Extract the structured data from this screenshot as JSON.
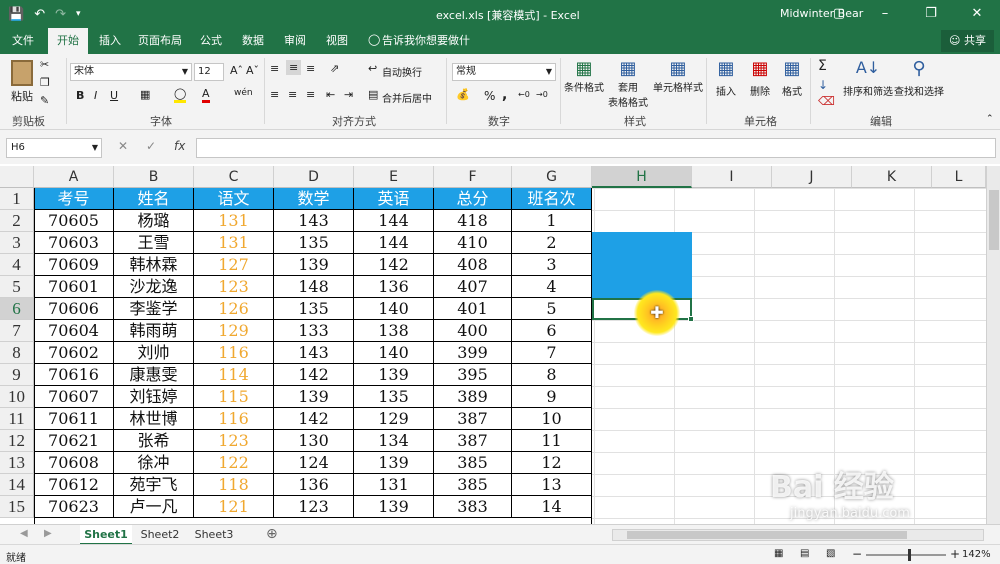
{
  "window": {
    "title": "excel.xls [兼容模式] - Excel",
    "user": "Midwinter Bear",
    "share_label": "共享"
  },
  "qat": {
    "save_icon": "save-icon",
    "undo_icon": "undo-icon",
    "redo_icon": "redo-icon"
  },
  "menu": {
    "tabs": [
      "文件",
      "开始",
      "插入",
      "页面布局",
      "公式",
      "数据",
      "审阅",
      "视图"
    ],
    "tell_me": "告诉我你想要做什么"
  },
  "ribbon": {
    "clipboard": {
      "paste": "粘贴",
      "label": "剪贴板"
    },
    "font": {
      "name": "宋体",
      "size": "12",
      "bold": "B",
      "italic": "I",
      "underline": "U",
      "label": "字体"
    },
    "alignment": {
      "wrap": "自动换行",
      "merge": "合并后居中",
      "label": "对齐方式"
    },
    "number": {
      "format": "常规",
      "percent": "%",
      "comma": ",",
      "label": "数字"
    },
    "styles": {
      "conditional": "条件格式",
      "table_line1": "套用",
      "table_line2": "表格格式",
      "cell_styles": "单元格样式",
      "label": "样式"
    },
    "cells": {
      "insert": "插入",
      "delete": "删除",
      "format": "格式",
      "label": "单元格"
    },
    "editing": {
      "sort": "排序和筛选",
      "find": "查找和选择",
      "label": "编辑"
    }
  },
  "formula_bar": {
    "name_box": "H6",
    "fx_label": "fx",
    "cancel": "✕",
    "enter": "✓",
    "value": ""
  },
  "grid": {
    "columns": [
      "A",
      "B",
      "C",
      "D",
      "E",
      "F",
      "G",
      "H",
      "I",
      "J",
      "K",
      "L"
    ],
    "row_numbers": [
      "1",
      "2",
      "3",
      "4",
      "5",
      "6",
      "7",
      "8",
      "9",
      "10",
      "11",
      "12",
      "13",
      "14",
      "15"
    ],
    "header_row": [
      "考号",
      "姓名",
      "语文",
      "数学",
      "英语",
      "总分",
      "班名次"
    ],
    "rows": [
      [
        "70605",
        "杨璐",
        "131",
        "143",
        "144",
        "418",
        "1"
      ],
      [
        "70603",
        "王雪",
        "131",
        "135",
        "144",
        "410",
        "2"
      ],
      [
        "70609",
        "韩林霖",
        "127",
        "139",
        "142",
        "408",
        "3"
      ],
      [
        "70601",
        "沙龙逸",
        "123",
        "148",
        "136",
        "407",
        "4"
      ],
      [
        "70606",
        "李鉴学",
        "126",
        "135",
        "140",
        "401",
        "5"
      ],
      [
        "70604",
        "韩雨萌",
        "129",
        "133",
        "138",
        "400",
        "6"
      ],
      [
        "70602",
        "刘帅",
        "116",
        "143",
        "140",
        "399",
        "7"
      ],
      [
        "70616",
        "康惠雯",
        "114",
        "142",
        "139",
        "395",
        "8"
      ],
      [
        "70607",
        "刘钰婷",
        "115",
        "139",
        "135",
        "389",
        "9"
      ],
      [
        "70611",
        "林世博",
        "116",
        "142",
        "129",
        "387",
        "10"
      ],
      [
        "70621",
        "张希",
        "123",
        "130",
        "134",
        "387",
        "11"
      ],
      [
        "70608",
        "徐冲",
        "122",
        "124",
        "139",
        "385",
        "12"
      ],
      [
        "70612",
        "苑宇飞",
        "118",
        "136",
        "131",
        "385",
        "13"
      ],
      [
        "70623",
        "卢一凡",
        "121",
        "123",
        "139",
        "383",
        "14"
      ]
    ],
    "selected_cell": "H6",
    "header_fill_color": "#1ea0e6",
    "highlight_color": "#f0a830"
  },
  "sheets": {
    "tabs": [
      "Sheet1",
      "Sheet2",
      "Sheet3"
    ],
    "add": "⊕"
  },
  "status": {
    "ready": "就绪",
    "zoom": "142%",
    "minus": "−",
    "plus": "+"
  },
  "watermark": {
    "brand": "Bai 经验",
    "url": "jingyan.baidu.com"
  }
}
